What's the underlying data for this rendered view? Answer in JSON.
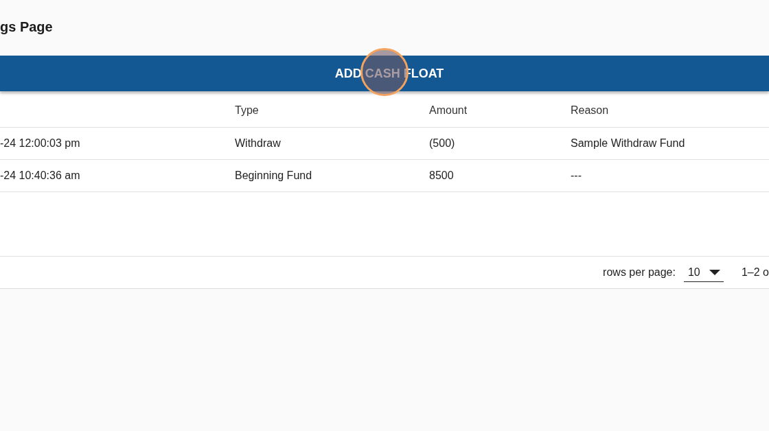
{
  "page": {
    "title": "gs Page"
  },
  "action_button": {
    "label": "ADD CASH FLOAT"
  },
  "click_indicator": {
    "on": true
  },
  "table": {
    "columns": [
      "Type",
      "Amount",
      "Reason"
    ],
    "rows": [
      {
        "date": "-24 12:00:03 pm",
        "type": "Withdraw",
        "amount": "(500)",
        "reason": "Sample Withdraw Fund"
      },
      {
        "date": "-24 10:40:36 am",
        "type": "Beginning Fund",
        "amount": "8500",
        "reason": "---"
      }
    ]
  },
  "pagination": {
    "rows_per_page_label": "rows per page:",
    "rows_per_page": "10",
    "range": "1–2 o"
  }
}
